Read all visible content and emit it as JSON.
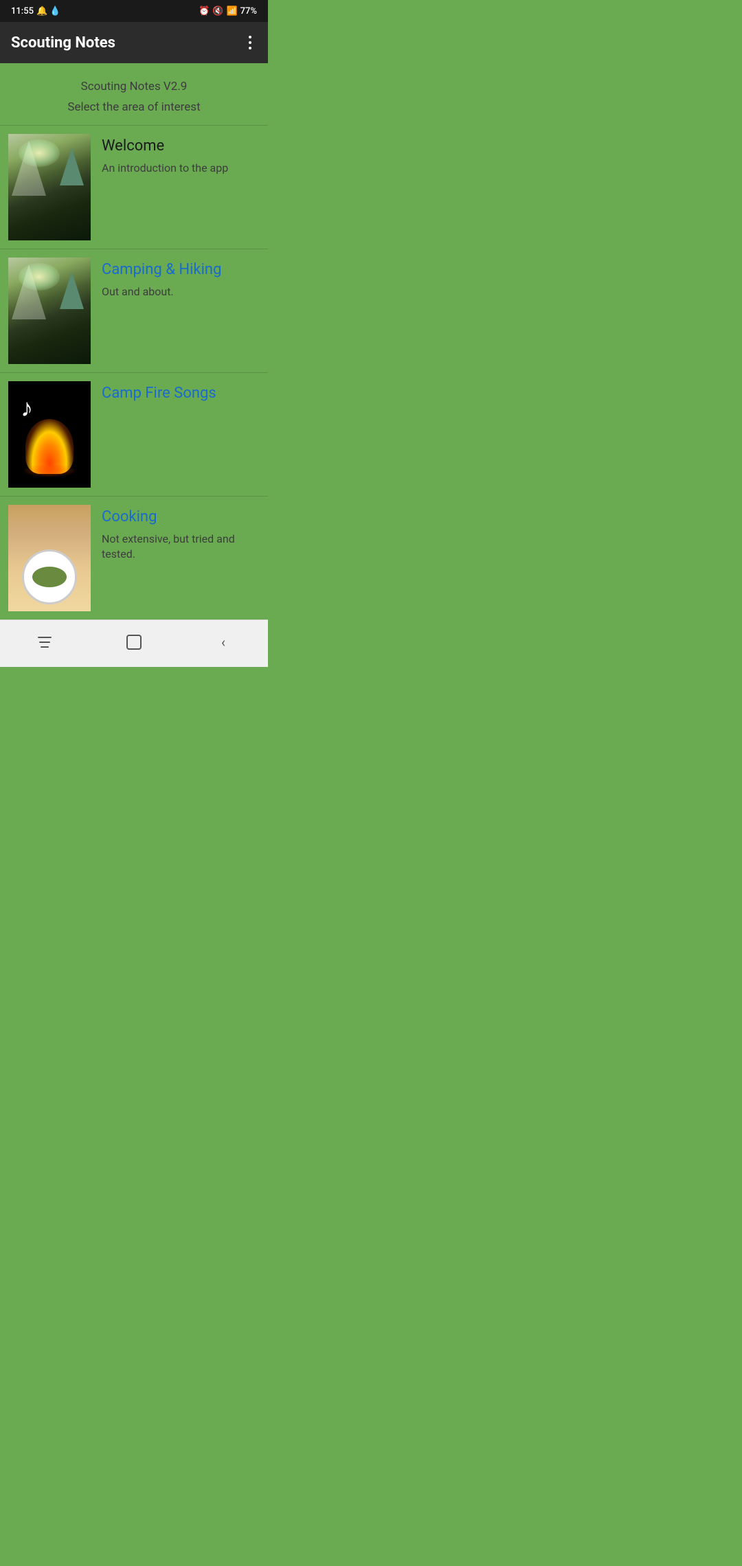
{
  "status": {
    "time": "11:55",
    "battery": "77%"
  },
  "appBar": {
    "title": "Scouting Notes",
    "moreIcon": "more-vertical-icon"
  },
  "header": {
    "version": "Scouting Notes V2.9",
    "subtitle": "Select the area of interest"
  },
  "items": [
    {
      "id": "welcome",
      "title": "Welcome",
      "titleStyle": "dark",
      "subtitle": "An introduction to the app",
      "imageType": "camping"
    },
    {
      "id": "camping-hiking",
      "title": "Camping & Hiking",
      "titleStyle": "blue",
      "subtitle": "Out and about.",
      "imageType": "camping"
    },
    {
      "id": "camp-fire-songs",
      "title": "Camp Fire Songs",
      "titleStyle": "blue",
      "subtitle": "",
      "imageType": "campfire"
    },
    {
      "id": "cooking",
      "title": "Cooking",
      "titleStyle": "blue",
      "subtitle": "Not extensive, but tried and tested.",
      "imageType": "cooking"
    }
  ],
  "navbar": {
    "recents": "recents-button",
    "home": "home-button",
    "back": "back-button"
  }
}
